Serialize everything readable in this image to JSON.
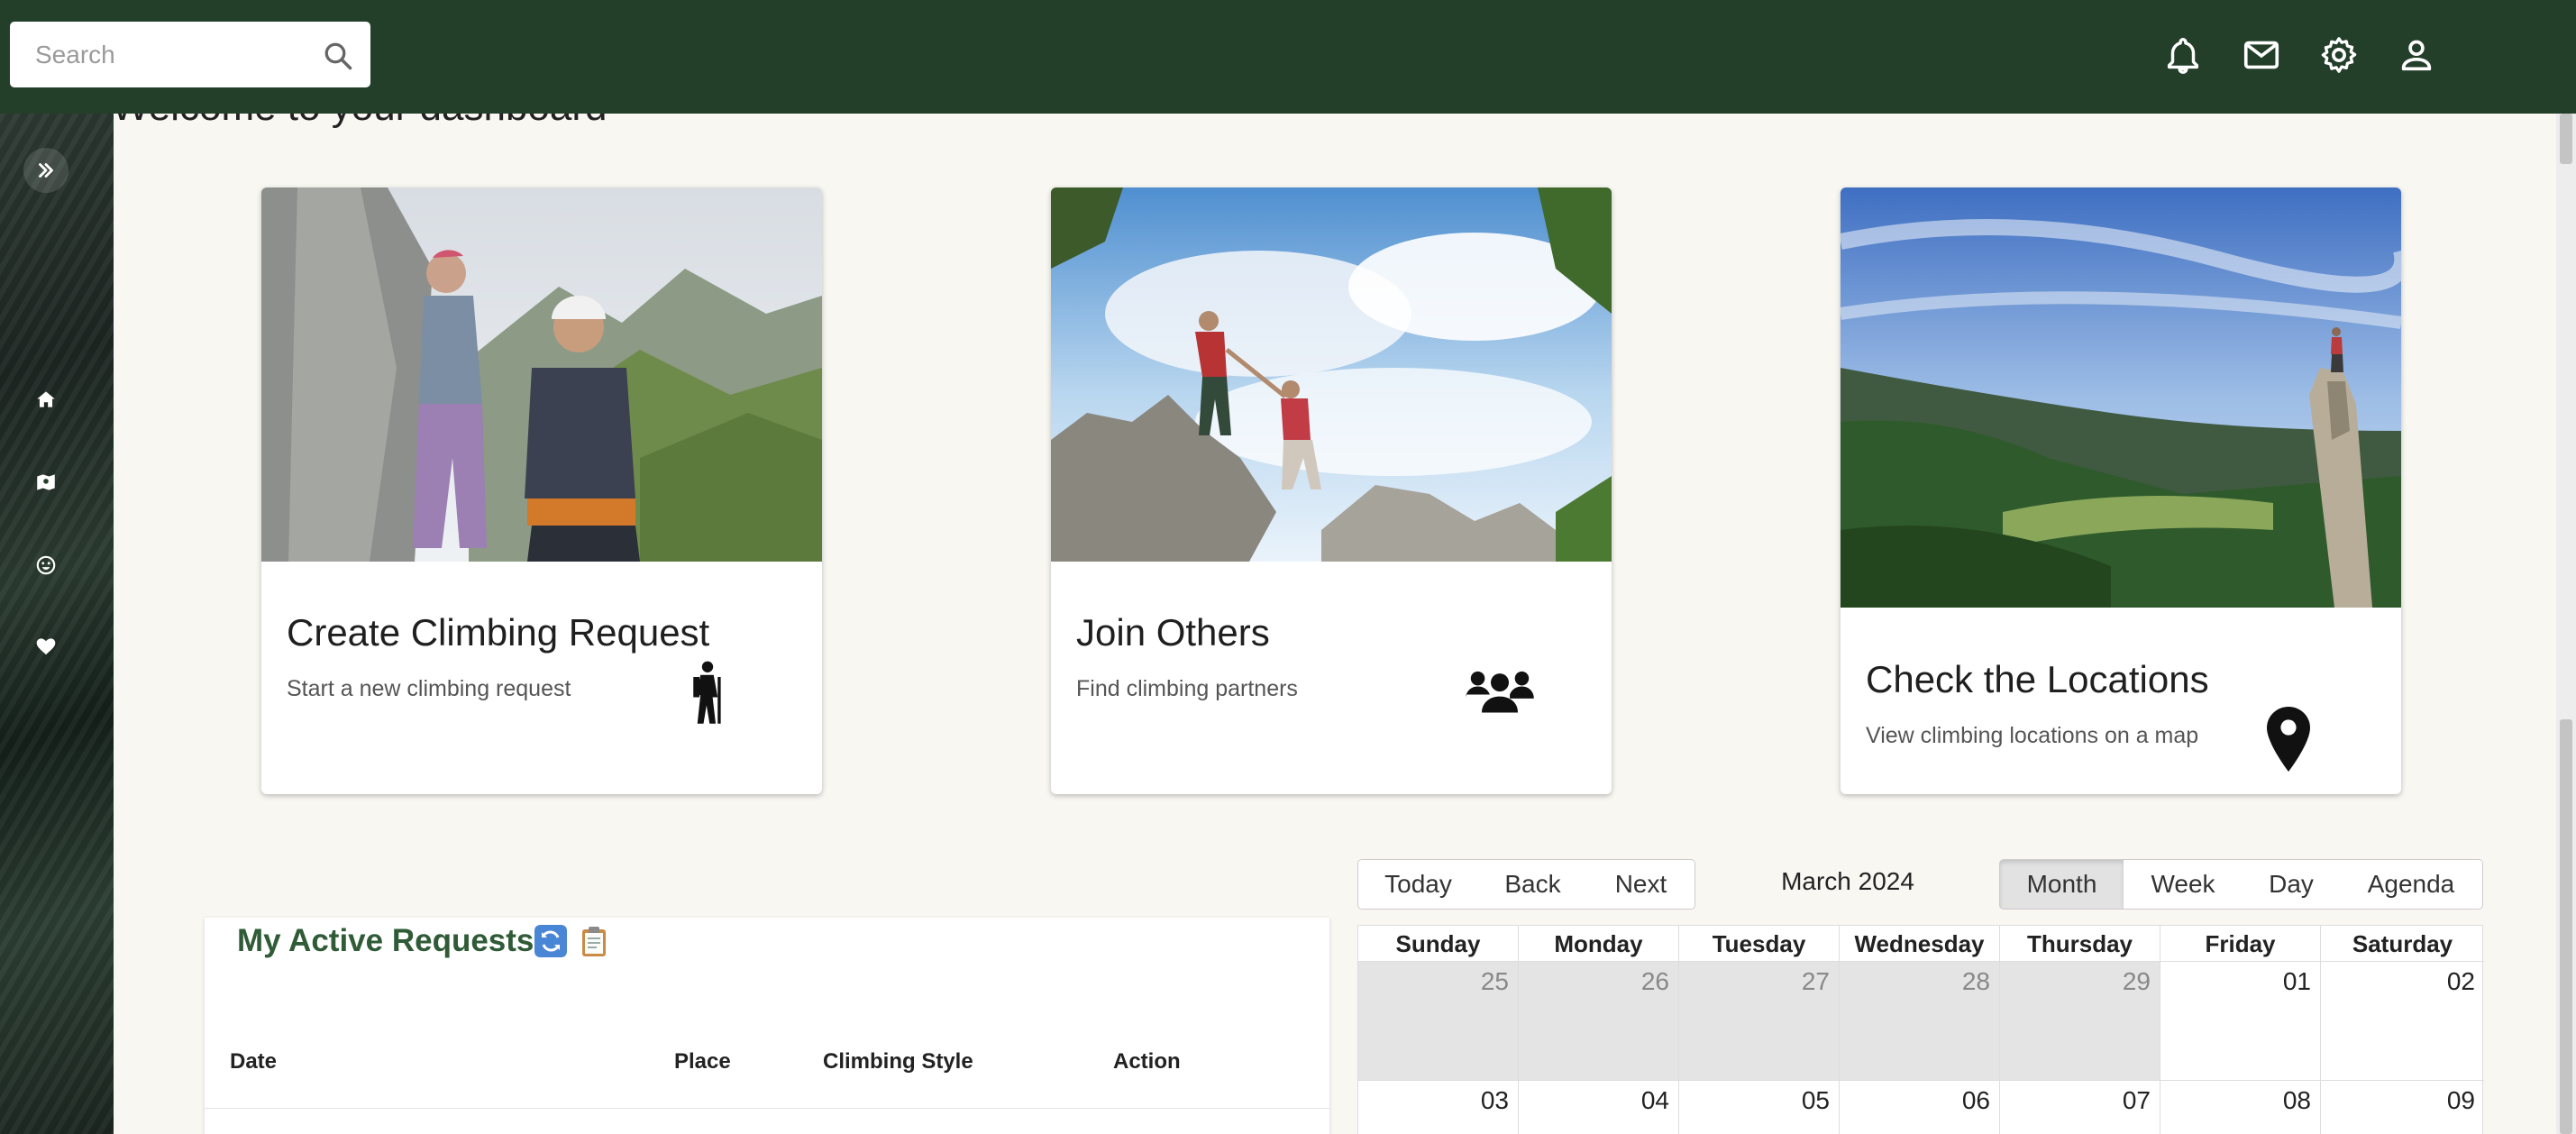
{
  "header": {
    "search_placeholder": "Search",
    "icons": [
      "bell-icon",
      "mail-icon",
      "gear-icon",
      "person-icon"
    ]
  },
  "sidebar": {
    "items": [
      {
        "icon": "expand-icon",
        "label": "Expand"
      },
      {
        "icon": "home-icon",
        "label": "Home"
      },
      {
        "icon": "map-icon",
        "label": "Map"
      },
      {
        "icon": "smile-icon",
        "label": "Social"
      },
      {
        "icon": "heart-icon",
        "label": "Favorites"
      }
    ]
  },
  "main": {
    "welcome": "Welcome to your dashboard",
    "cards": [
      {
        "title": "Create Climbing Request",
        "subtitle": "Start a new climbing request",
        "icon": "hiker-icon"
      },
      {
        "title": "Join Others",
        "subtitle": "Find climbing partners",
        "icon": "group-icon"
      },
      {
        "title": "Check the Locations",
        "subtitle": "View climbing locations on a map",
        "icon": "map-pin-icon"
      }
    ]
  },
  "requests": {
    "title": "My Active Requests",
    "title_icons": [
      "refresh-icon",
      "clipboard-icon"
    ],
    "columns": [
      "Date",
      "Place",
      "Climbing Style",
      "Action"
    ]
  },
  "calendar": {
    "nav": {
      "today": "Today",
      "back": "Back",
      "next": "Next"
    },
    "label": "March 2024",
    "views": {
      "month": "Month",
      "week": "Week",
      "day": "Day",
      "agenda": "Agenda",
      "active": "Month"
    },
    "weekdays": [
      "Sunday",
      "Monday",
      "Tuesday",
      "Wednesday",
      "Thursday",
      "Friday",
      "Saturday"
    ],
    "weeks": [
      [
        {
          "d": "25",
          "off": true
        },
        {
          "d": "26",
          "off": true
        },
        {
          "d": "27",
          "off": true
        },
        {
          "d": "28",
          "off": true
        },
        {
          "d": "29",
          "off": true
        },
        {
          "d": "01",
          "off": false
        },
        {
          "d": "02",
          "off": false
        }
      ],
      [
        {
          "d": "03",
          "off": false
        },
        {
          "d": "04",
          "off": false
        },
        {
          "d": "05",
          "off": false
        },
        {
          "d": "06",
          "off": false
        },
        {
          "d": "07",
          "off": false
        },
        {
          "d": "08",
          "off": false
        },
        {
          "d": "09",
          "off": false
        }
      ]
    ]
  },
  "colors": {
    "header": "#233f2a",
    "accent_green": "#2f5b37",
    "background": "#f8f7f2"
  }
}
